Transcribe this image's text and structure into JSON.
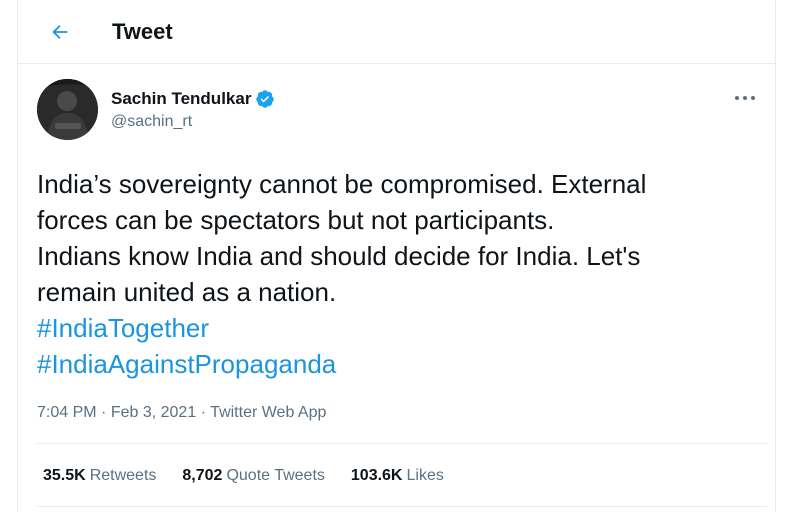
{
  "header": {
    "title": "Tweet",
    "back_icon": "arrow-left-icon"
  },
  "author": {
    "name": "Sachin Tendulkar",
    "handle": "@sachin_rt",
    "verified_icon": "verified-badge-icon"
  },
  "tweet": {
    "text": "India’s sovereignty cannot be compromised. External\nforces can be spectators but not participants.\nIndians know India and should decide for India. Let's\nremain united as a nation.",
    "hashtags": [
      "#IndiaTogether",
      "#IndiaAgainstPropaganda"
    ]
  },
  "meta": {
    "time": "7:04 PM",
    "date": "Feb 3, 2021",
    "source": "Twitter Web App",
    "separator": "·"
  },
  "stats": {
    "retweets_count": "35.5K",
    "retweets_label": "Retweets",
    "quotes_count": "8,702",
    "quotes_label": "Quote Tweets",
    "likes_count": "103.6K",
    "likes_label": "Likes"
  },
  "colors": {
    "accent": "#1b95e0",
    "text": "#0f1419",
    "muted": "#5b7083",
    "border": "#e6ecf0"
  }
}
